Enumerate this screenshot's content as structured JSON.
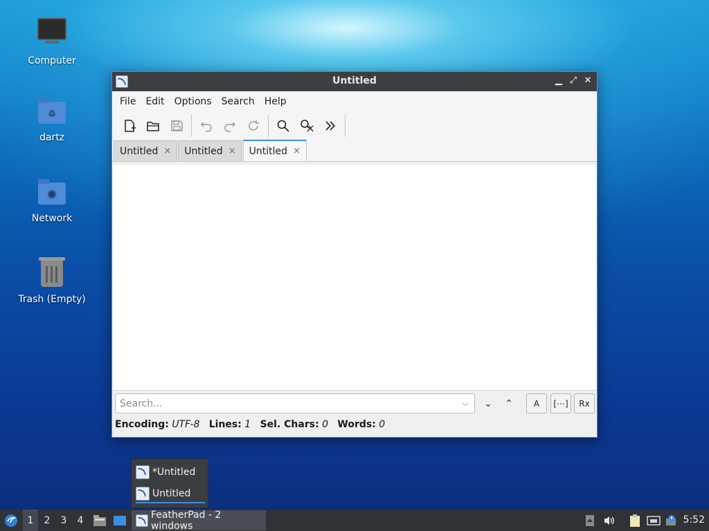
{
  "desktop": {
    "icons": [
      {
        "label": "Computer"
      },
      {
        "label": "dartz"
      },
      {
        "label": "Network"
      },
      {
        "label": "Trash (Empty)"
      }
    ]
  },
  "window": {
    "title": "Untitled",
    "controls": {
      "minimize": "▁",
      "maximize": "⤢",
      "close": "✕"
    },
    "menu": [
      "File",
      "Edit",
      "Options",
      "Search",
      "Help"
    ],
    "toolbar": {
      "icons": [
        "new-document-icon",
        "open-folder-icon",
        "save-icon",
        "undo-icon",
        "redo-icon",
        "reload-icon",
        "find-icon",
        "replace-icon",
        "more-icon"
      ]
    },
    "tabs": [
      {
        "label": "Untitled",
        "close": "×"
      },
      {
        "label": "Untitled",
        "close": "×"
      },
      {
        "label": "Untitled",
        "close": "×"
      }
    ],
    "active_tab_index": 2,
    "editor_text": "",
    "search": {
      "placeholder": "Search...",
      "dropdown": "⌵",
      "next": "⌄",
      "previous": "⌃",
      "match_case": "A",
      "whole_word": "[⋯]",
      "regex": "Rx"
    },
    "status": {
      "encoding_label": "Encoding:",
      "encoding_value": "UTF-8",
      "lines_label": "Lines:",
      "lines_value": "1",
      "sel_label": "Sel. Chars:",
      "sel_value": "0",
      "words_label": "Words:",
      "words_value": "0"
    }
  },
  "task_popup": {
    "items": [
      {
        "label": "*Untitled"
      },
      {
        "label": "Untitled"
      }
    ]
  },
  "taskbar": {
    "workspaces": [
      "1",
      "2",
      "3",
      "4"
    ],
    "active_workspace": "1",
    "task_button": "FeatherPad - 2 windows",
    "clock": "5:52"
  },
  "colors": {
    "accent": "#3d8ee2",
    "titlebar": "#3b3f44",
    "taskbar": "#2f3236"
  }
}
